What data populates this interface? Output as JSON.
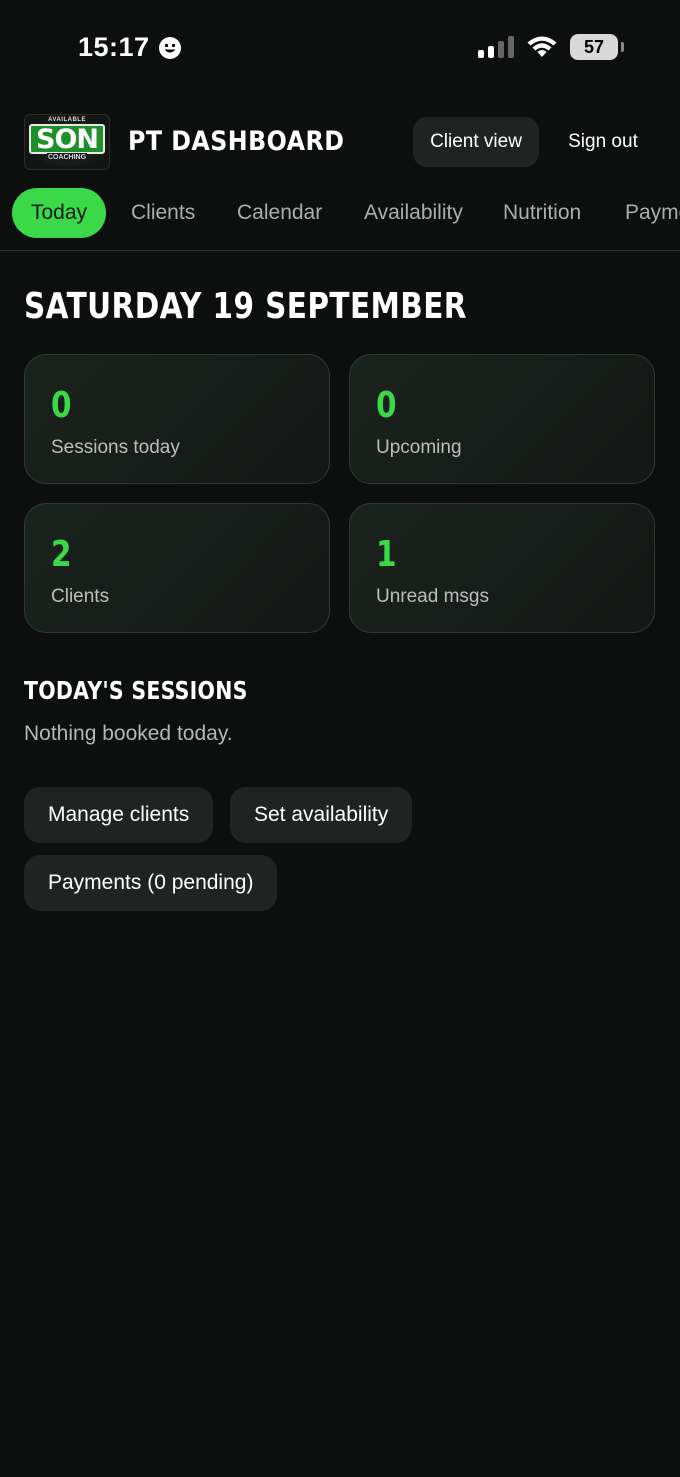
{
  "status_bar": {
    "time": "15:17",
    "battery": "57",
    "icons": [
      "smiley-icon",
      "signal-icon",
      "wifi-icon",
      "battery-icon"
    ]
  },
  "header": {
    "logo": {
      "top_text": "AVAILABLE",
      "main_text": "SON",
      "sub_text": "COACHING"
    },
    "title": "PT DASHBOARD",
    "client_view_label": "Client view",
    "sign_out_label": "Sign out"
  },
  "tabs": [
    {
      "label": "Today",
      "active": true
    },
    {
      "label": "Clients",
      "active": false
    },
    {
      "label": "Calendar",
      "active": false
    },
    {
      "label": "Availability",
      "active": false
    },
    {
      "label": "Nutrition",
      "active": false
    },
    {
      "label": "Payme",
      "active": false
    }
  ],
  "date_heading": "SATURDAY 19 SEPTEMBER",
  "stats": [
    {
      "value": "0",
      "label": "Sessions today"
    },
    {
      "value": "0",
      "label": "Upcoming"
    },
    {
      "value": "2",
      "label": "Clients"
    },
    {
      "value": "1",
      "label": "Unread msgs"
    }
  ],
  "sessions": {
    "title": "TODAY'S SESSIONS",
    "empty_text": "Nothing booked today."
  },
  "actions": {
    "manage_clients": "Manage clients",
    "set_availability": "Set availability",
    "payments": "Payments (0 pending)"
  },
  "colors": {
    "background": "#0d0f0e",
    "accent": "#3bd949",
    "card_bg": "#1b231e",
    "button_bg": "#1f2422"
  }
}
